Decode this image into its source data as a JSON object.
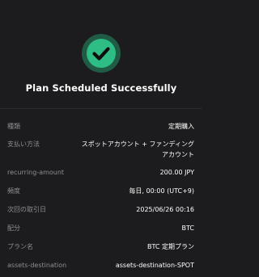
{
  "header": {
    "title": "Plan Scheduled Successfully"
  },
  "colors": {
    "background": "#1c1c1e",
    "accent": "#2ebd85",
    "accent_ring": "#1f5b45",
    "label": "#8e8e93",
    "value": "#ffffff"
  },
  "icons": {
    "success": "check-circle-icon"
  },
  "details": [
    {
      "label": "種類",
      "value": "定期購入"
    },
    {
      "label": "支払い方法",
      "value": "スポットアカウント + ファンディングアカウント"
    },
    {
      "label": "recurring-amount",
      "value": "200.00 JPY"
    },
    {
      "label": "頻度",
      "value": "毎日, 00:00 (UTC+9)"
    },
    {
      "label": "次回の取引日",
      "value": "2025/06/26 00:16"
    },
    {
      "label": "配分",
      "value": "BTC"
    },
    {
      "label": "プラン名",
      "value": "BTC 定期プラン"
    },
    {
      "label": "assets-destination",
      "value": "assets-destination-SPOT"
    }
  ]
}
